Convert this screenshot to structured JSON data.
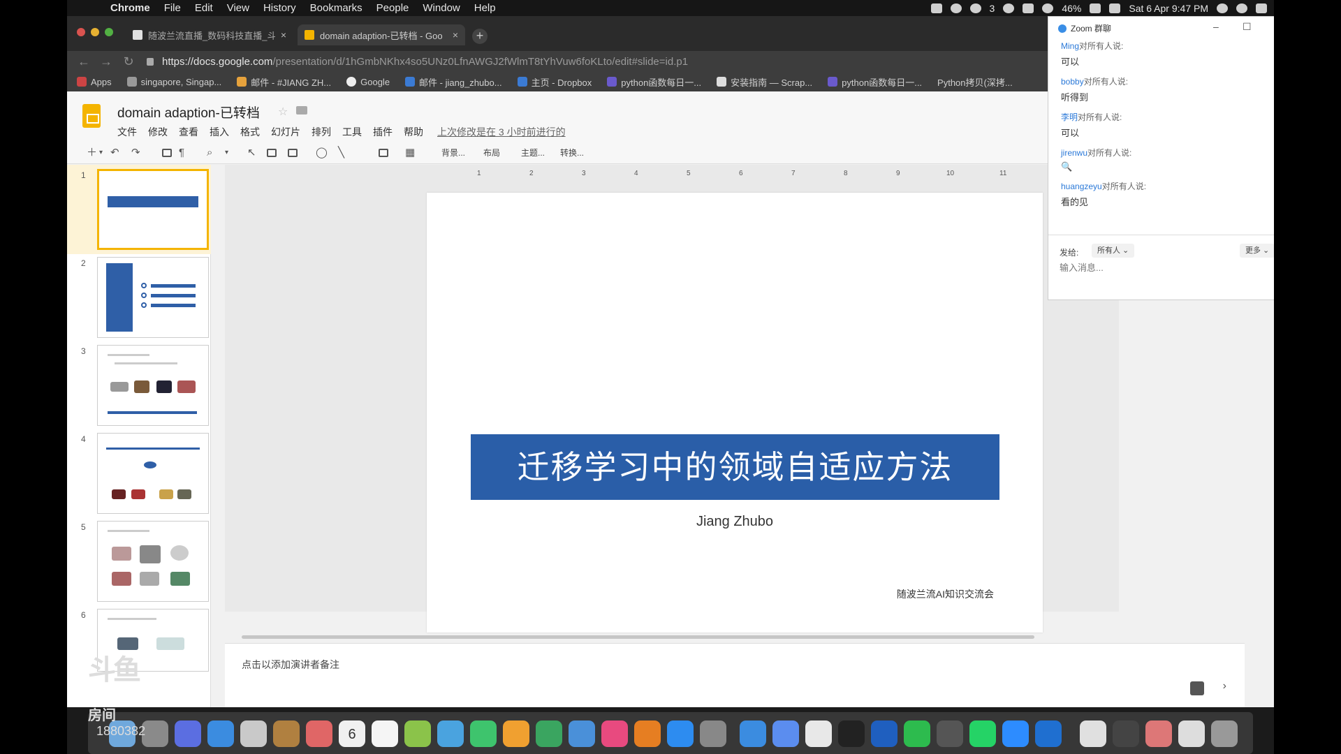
{
  "menubar": {
    "app": "Chrome",
    "items": [
      "File",
      "Edit",
      "View",
      "History",
      "Bookmarks",
      "People",
      "Window",
      "Help"
    ],
    "wechat_count": "3",
    "battery": "46%",
    "clock": "Sat 6 Apr  9:47 PM"
  },
  "tabs": [
    {
      "label": "随波兰流直播_数码科技直播_斗",
      "close": "×",
      "active": false
    },
    {
      "label": "domain adaption-已转档 - Goo",
      "close": "×",
      "active": true
    }
  ],
  "newtab": "+",
  "url": {
    "host": "https://docs.google.com",
    "path": "/presentation/d/1hGmbNKhx4so5UNz0LfnAWGJ2fWlmT8tYhVuw6foKLto/edit#slide=id.p1"
  },
  "bookmarks": [
    "Apps",
    "singapore, Singap...",
    "邮件 - #JIANG ZH...",
    "Google",
    "邮件 - jiang_zhubo...",
    "主页 - Dropbox",
    "python函数每日一...",
    "安装指南 — Scrap...",
    "python函数每日一...",
    "Python拷贝(深拷..."
  ],
  "slides": {
    "title": "domain adaption-已转档",
    "menu": [
      "文件",
      "修改",
      "查看",
      "插入",
      "格式",
      "幻灯片",
      "排列",
      "工具",
      "插件",
      "帮助"
    ],
    "last_edit": "上次修改是在 3 小时前进行的",
    "toolbar_text": {
      "background": "背景...",
      "layout": "布局",
      "theme": "主题...",
      "transition": "转换..."
    },
    "thumb_numbers": [
      "1",
      "2",
      "3",
      "4",
      "5",
      "6"
    ],
    "ruler_numbers": [
      "1",
      "2",
      "3",
      "4",
      "5",
      "6",
      "7",
      "8",
      "9",
      "10",
      "11"
    ],
    "current_slide": {
      "heading": "迁移学习中的领域自适应方法",
      "author": "Jiang Zhubo",
      "footer": "随波兰流AI知识交流会"
    },
    "notes_placeholder": "点击以添加演讲者备注",
    "accent": "#2a5ea8"
  },
  "zoom_chat": {
    "window_title": "Zoom 群聊",
    "messages": [
      {
        "sender": "Ming",
        "to": "对所有人说:",
        "text": "可以"
      },
      {
        "sender": "bobby",
        "to": "对所有人说:",
        "text": "听得到"
      },
      {
        "sender": "李明",
        "to": "对所有人说:",
        "text": "可以"
      },
      {
        "sender": "jirenwu",
        "to": "对所有人说:",
        "text": "🔍"
      },
      {
        "sender": "huangzeyu",
        "to": "对所有人说:",
        "text": "看的见"
      }
    ],
    "send_to_label": "发给:",
    "recipient": "所有人",
    "more": "更多",
    "input_placeholder": "输入消息..."
  },
  "watermark": {
    "logo": "斗鱼",
    "room_label": "房间",
    "room_number": "1880382"
  },
  "dock": {
    "apps": [
      "finder-icon",
      "launchpad-icon",
      "siri-icon",
      "safari-icon",
      "mail-icon",
      "notes-book-icon",
      "photos-icon",
      "calendar-icon",
      "reminders-icon",
      "maps-icon",
      "messages-icon",
      "facetime-icon",
      "pages-icon",
      "numbers-icon",
      "keynote-icon",
      "music-icon",
      "books-icon",
      "app-store-icon",
      "preferences-icon",
      "bird-icon",
      "baidu-icon",
      "chrome-icon",
      "terminal-icon",
      "trello-icon",
      "wechat-icon",
      "ssh-icon",
      "whatsapp-icon",
      "zoom-icon",
      "teamviewer-icon",
      "document-icon",
      "monitor-icon",
      "image-icon",
      "preview-icon",
      "trash-icon"
    ],
    "calendar_day": "6"
  }
}
